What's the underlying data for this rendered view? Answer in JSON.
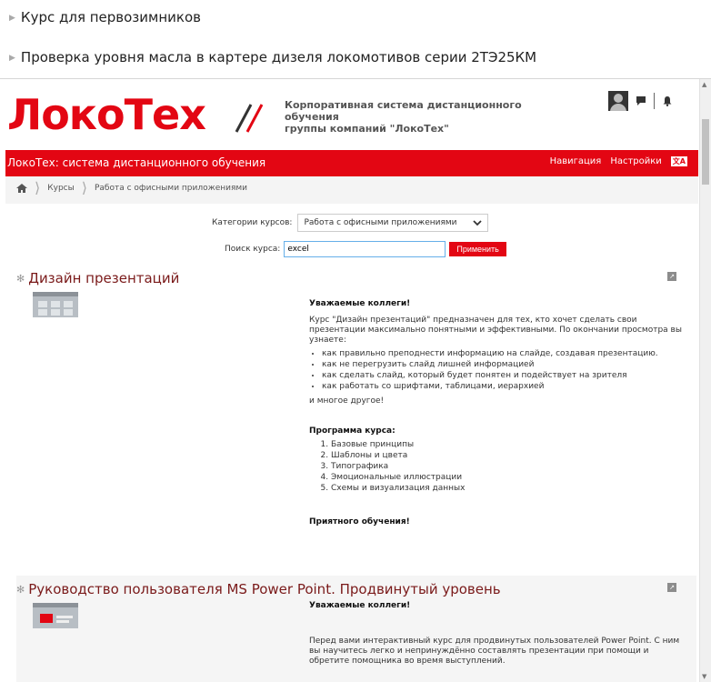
{
  "outer_list": [
    {
      "label": "Курс для первозимников"
    },
    {
      "label": "Проверка уровня масла в картере дизеля локомотивов серии 2ТЭ25КМ"
    }
  ],
  "header": {
    "logo_text": "ЛокоТех",
    "org_line1": "Корпоративная система дистанционного обучения",
    "org_line2": "группы компаний \"ЛокоТех\""
  },
  "navbar": {
    "brand": "ЛокоТех: система дистанционного обучения",
    "links": [
      "Навигация",
      "Настройки"
    ]
  },
  "breadcrumb": {
    "items": [
      "Курсы",
      "Работа с офисными приложениями"
    ]
  },
  "filter": {
    "label": "Категории курсов:",
    "selected": "Работа с офисными приложениями"
  },
  "search": {
    "label": "Поиск курса:",
    "value": "excel",
    "button": "Применить"
  },
  "courses": [
    {
      "title": "Дизайн презентаций",
      "greeting": "Уважаемые коллеги!",
      "intro": "Курс \"Дизайн презентаций\" предназначен для тех, кто хочет сделать свои презентации максимально понятными и эффективными. По окончании просмотра вы узнаете:",
      "bullets": [
        "как правильно преподнести информацию на слайде, создавая презентацию.",
        "как не перегрузить слайд лишней информацией",
        "как сделать слайд, который будет понятен и подействует на зрителя",
        "как работать со шрифтами, таблицами, иерархией"
      ],
      "more": "и многое другое!",
      "program_title": "Программа курса:",
      "program": [
        "Базовые принципы",
        "Шаблоны и цвета",
        "Типографика",
        "Эмоциональные иллюстрации",
        "Схемы и визуализация данных"
      ],
      "closing": "Приятного обучения!"
    },
    {
      "title": "Руководство пользователя MS Power Point. Продвинутый уровень",
      "greeting": "Уважаемые коллеги!",
      "intro": "Перед вами интерактивный курс для продвинутых пользователей Power Point. С ним вы научитесь легко и непринуждённо составлять презентации при помощи и обретите помощника во время выступлений."
    }
  ],
  "colors": {
    "brand_red": "#e30613",
    "course_title": "#7a1a1a"
  }
}
